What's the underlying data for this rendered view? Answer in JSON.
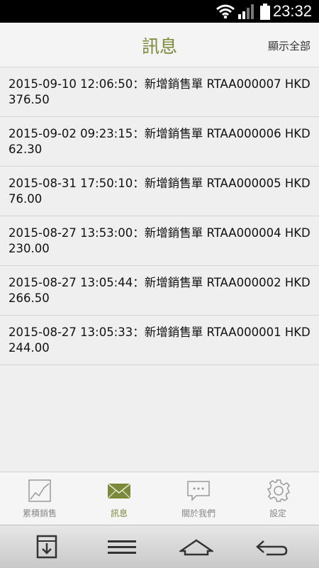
{
  "status_bar": {
    "time": "23:32"
  },
  "header": {
    "title": "訊息",
    "show_all_label": "顯示全部"
  },
  "messages": [
    {
      "text": "2015-09-10 12:06:50：新增銷售單 RTAA000007 HKD 376.50"
    },
    {
      "text": "2015-09-02 09:23:15：新增銷售單 RTAA000006 HKD 62.30"
    },
    {
      "text": "2015-08-31 17:50:10：新增銷售單 RTAA000005 HKD 76.00"
    },
    {
      "text": "2015-08-27 13:53:00：新增銷售單 RTAA000004 HKD 230.00"
    },
    {
      "text": "2015-08-27 13:05:44：新增銷售單 RTAA000002 HKD 266.50"
    },
    {
      "text": "2015-08-27 13:05:33：新增銷售單 RTAA000001 HKD 244.00"
    }
  ],
  "tabs": [
    {
      "label": "累積銷售",
      "icon": "chart-icon"
    },
    {
      "label": "訊息",
      "icon": "mail-icon",
      "active": true
    },
    {
      "label": "關於我們",
      "icon": "chat-icon"
    },
    {
      "label": "設定",
      "icon": "gear-icon"
    }
  ],
  "colors": {
    "accent": "#7a8a3a"
  }
}
